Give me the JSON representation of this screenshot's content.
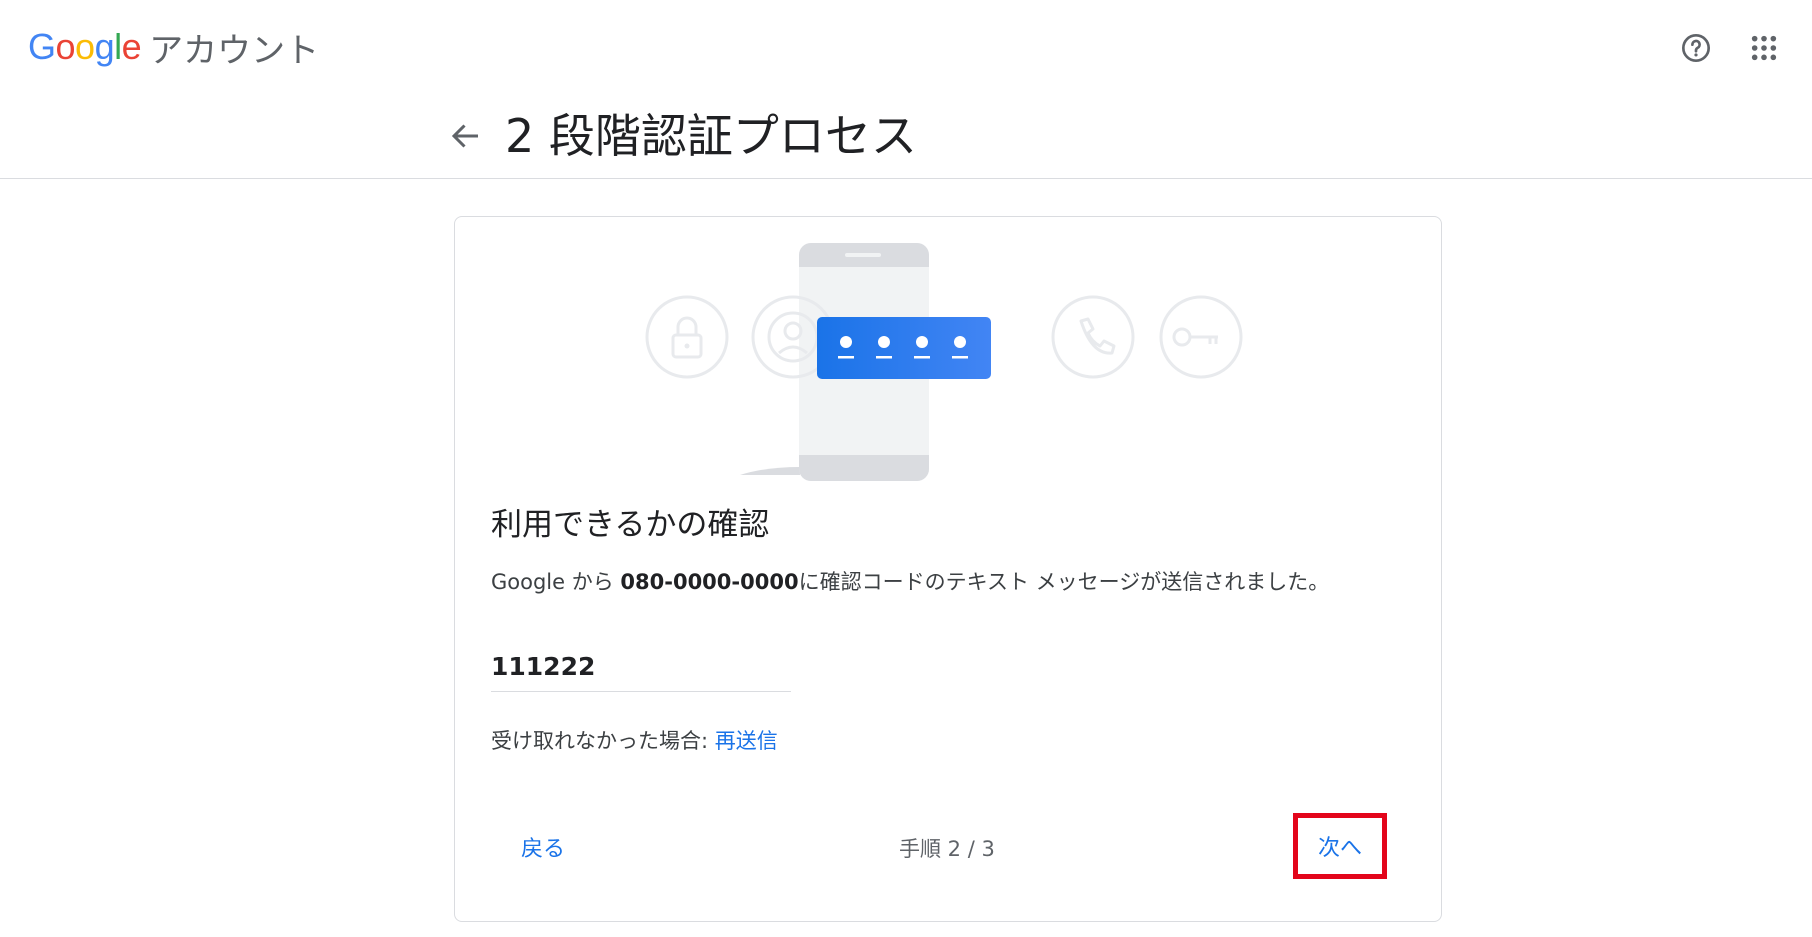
{
  "header": {
    "logo_letters": [
      "G",
      "o",
      "o",
      "g",
      "l",
      "e"
    ],
    "product": "アカウント",
    "help_icon": "help-circle-icon",
    "apps_icon": "apps-grid-icon"
  },
  "page": {
    "title": "2 段階認証プロセス",
    "back_icon": "arrow-left-icon"
  },
  "card": {
    "heading": "利用できるかの確認",
    "description_prefix": "Google から ",
    "phone_number": "080-0000-0000",
    "description_suffix": "に確認コードのテキスト メッセージが送信されました。",
    "code_value": "111222",
    "resend_prefix": "受け取れなかった場合: ",
    "resend_link": "再送信",
    "back_button": "戻る",
    "step_text": "手順 2 / 3",
    "next_button": "次へ"
  },
  "illustration": {
    "icons": [
      "lock-icon",
      "account-icon",
      "password-dots-icon",
      "phone-icon",
      "key-icon"
    ]
  },
  "colors": {
    "accent": "#1a73e8",
    "highlight": "#e3051b",
    "google_blue": "#4285F4",
    "google_red": "#EA4335",
    "google_yellow": "#FBBC05",
    "google_green": "#34A853"
  }
}
